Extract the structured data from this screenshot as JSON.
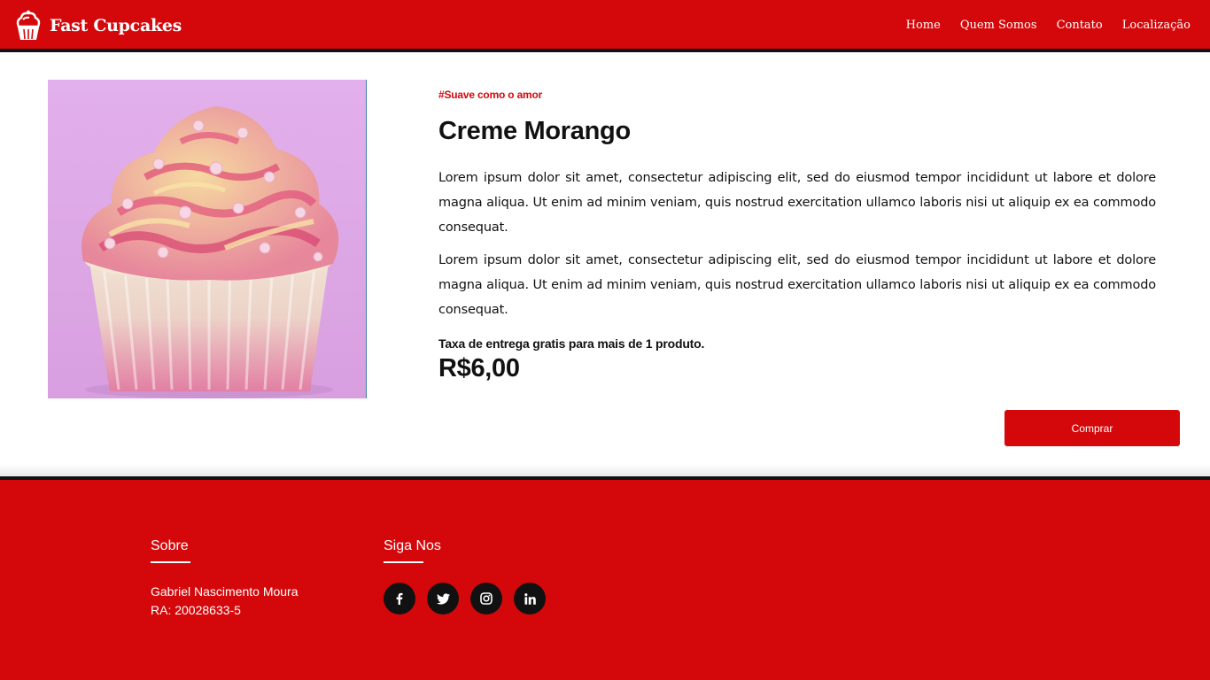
{
  "header": {
    "brand_name": "Fast Cupcakes",
    "logo_icon": "cupcake-icon",
    "nav": [
      {
        "label": "Home"
      },
      {
        "label": "Quem Somos"
      },
      {
        "label": "Contato"
      },
      {
        "label": "Localização"
      }
    ]
  },
  "product": {
    "image_icon": "cupcake-photo",
    "tag": "#Suave como o amor",
    "title": "Creme Morango",
    "description": [
      "Lorem ipsum dolor sit amet, consectetur adipiscing elit, sed do eiusmod tempor incididunt ut labore et dolore magna aliqua. Ut enim ad minim veniam, quis nostrud exercitation ullamco laboris nisi ut aliquip ex ea commodo consequat.",
      "Lorem ipsum dolor sit amet, consectetur adipiscing elit, sed do eiusmod tempor incididunt ut labore et dolore magna aliqua. Ut enim ad minim veniam, quis nostrud exercitation ullamco laboris nisi ut aliquip ex ea commodo consequat."
    ],
    "delivery_note": "Taxa de entrega gratis para mais de 1 produto.",
    "price": "R$6,00",
    "buy_label": "Comprar"
  },
  "footer": {
    "about_heading": "Sobre",
    "about_lines": [
      "Gabriel Nascimento Moura",
      "RA: 20028633-5"
    ],
    "social_heading": "Siga Nos",
    "social_icons": [
      "facebook-icon",
      "twitter-icon",
      "instagram-icon",
      "linkedin-icon"
    ]
  },
  "colors": {
    "brand_red": "#d4080b",
    "dark": "#111111",
    "white": "#ffffff"
  }
}
